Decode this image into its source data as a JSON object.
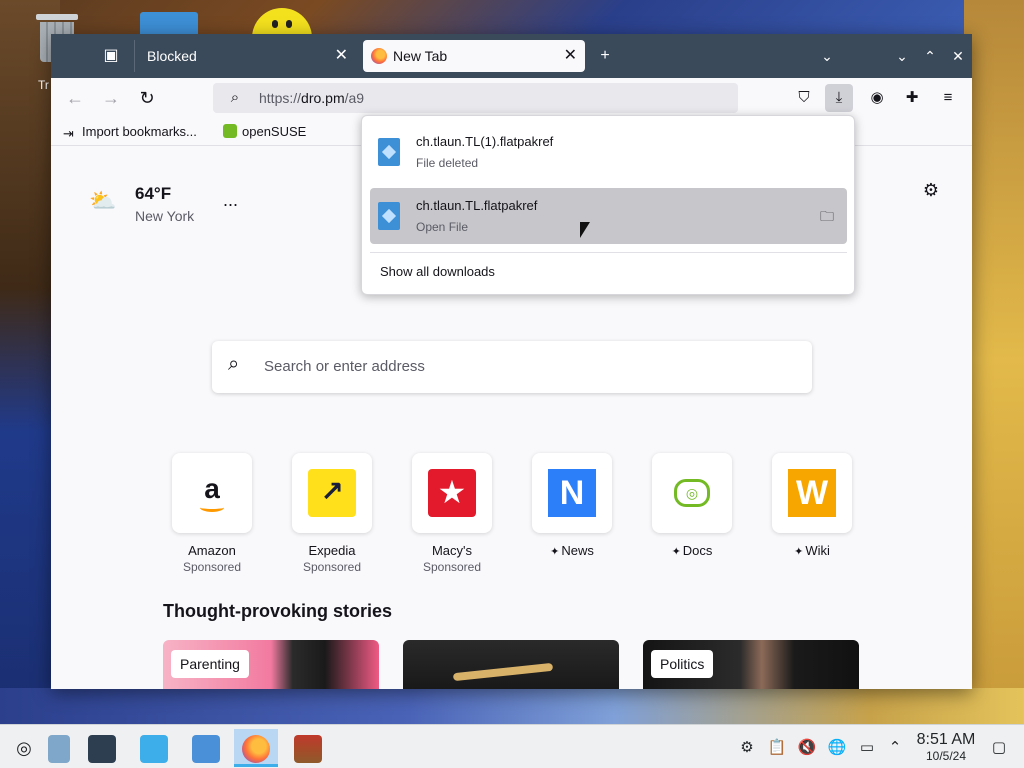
{
  "desktop": {
    "trash_label": "Tr"
  },
  "browser": {
    "tabs": [
      {
        "label": "Blocked",
        "active": false
      },
      {
        "label": "New Tab",
        "active": true
      }
    ],
    "url": {
      "prefix": "https://",
      "domain": "dro.pm",
      "path": "/a9"
    },
    "bookmarks": [
      {
        "label": "Import bookmarks..."
      },
      {
        "label": "openSUSE"
      }
    ]
  },
  "downloads": {
    "items": [
      {
        "name": "ch.tlaun.TL(1).flatpakref",
        "status": "File deleted"
      },
      {
        "name": "ch.tlaun.TL.flatpakref",
        "status": "Open File"
      }
    ],
    "show_all": "Show all downloads"
  },
  "newtab": {
    "weather": {
      "temp": "64°F",
      "city": "New York",
      "more": "..."
    },
    "search_placeholder": "Search or enter address",
    "top_sites": [
      {
        "name": "Amazon",
        "sponsored": "Sponsored",
        "pinned": false,
        "logo_text": "a"
      },
      {
        "name": "Expedia",
        "sponsored": "Sponsored",
        "pinned": false,
        "logo_text": "↗"
      },
      {
        "name": "Macy's",
        "sponsored": "Sponsored",
        "pinned": false,
        "logo_text": "★"
      },
      {
        "name": "News",
        "sponsored": "",
        "pinned": true,
        "logo_text": "N"
      },
      {
        "name": "Docs",
        "sponsored": "",
        "pinned": true,
        "logo_text": "◎"
      },
      {
        "name": "Wiki",
        "sponsored": "",
        "pinned": true,
        "logo_text": "W"
      }
    ],
    "stories_title": "Thought-provoking stories",
    "stories": [
      {
        "tag": "Parenting"
      },
      {
        "tag": ""
      },
      {
        "tag": "Politics"
      }
    ]
  },
  "taskbar": {
    "time": "8:51 AM",
    "date": "10/5/24"
  }
}
